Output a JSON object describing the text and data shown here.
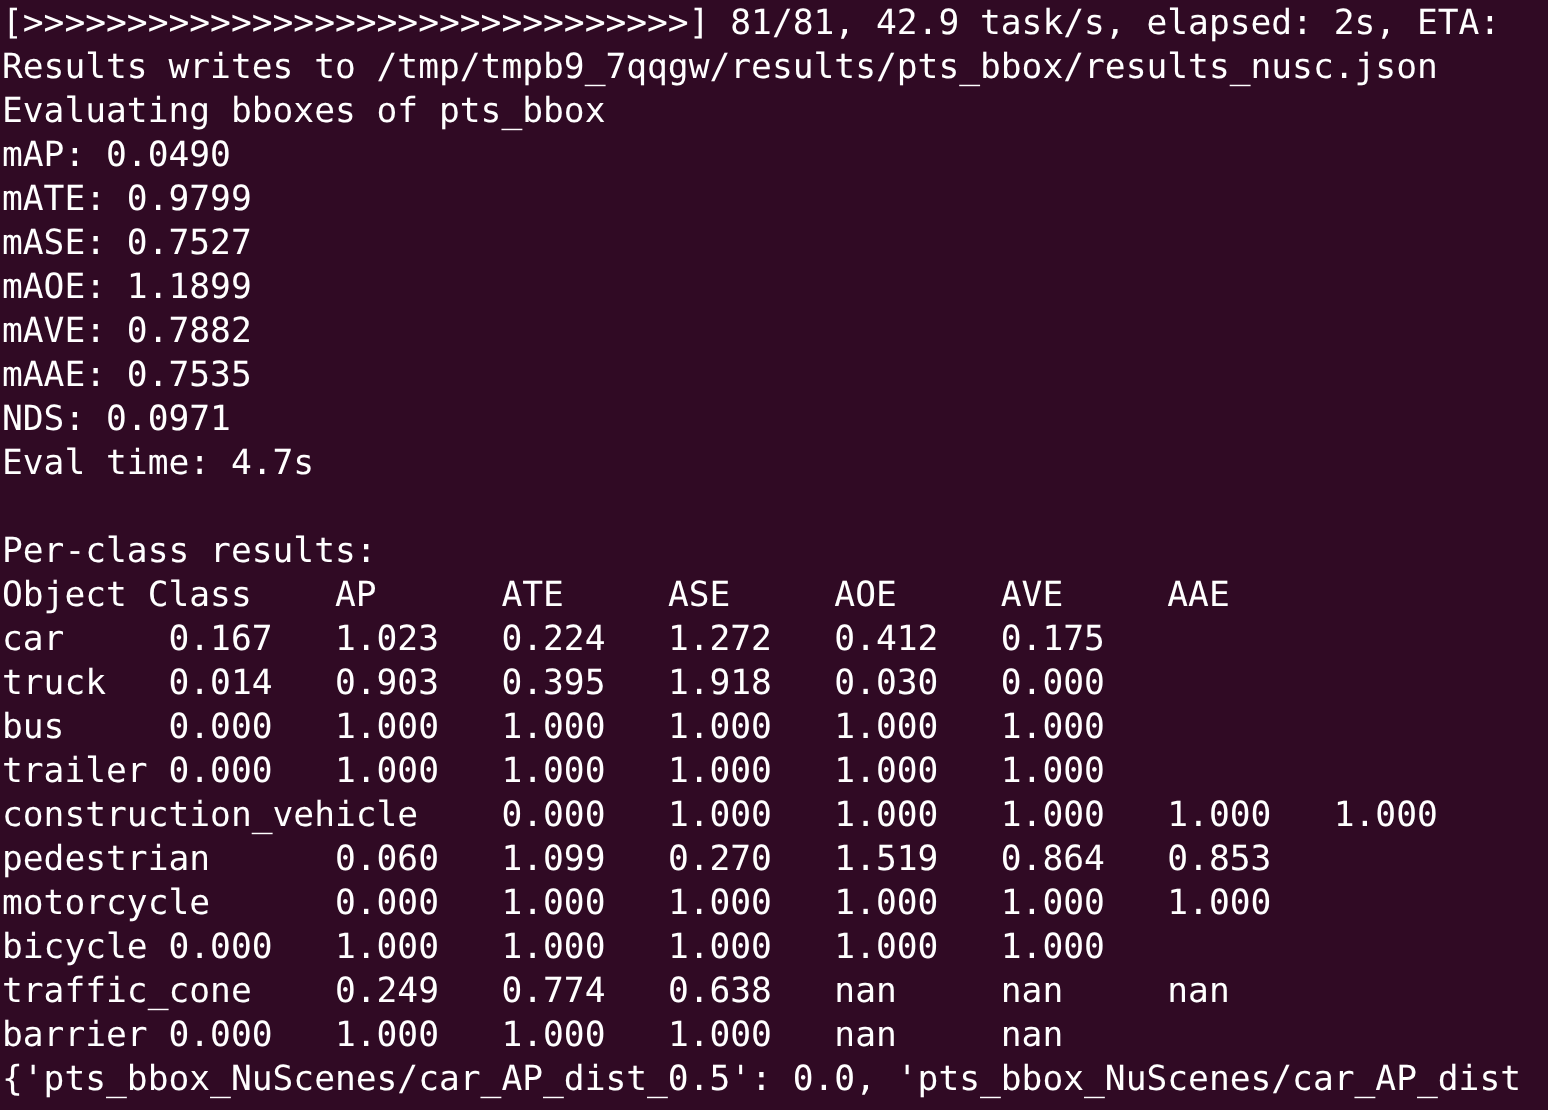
{
  "terminal": {
    "blocks": [
      {
        "lines": [
          "[>>>>>>>>>>>>>>>>>>>>>>>>>>>>>>>>] 81/81, 42.9 task/s, elapsed: 2s, ETA:",
          "Results writes to /tmp/tmpb9_7qqgw/results/pts_bbox/results_nusc.json",
          "Evaluating bboxes of pts_bbox",
          "mAP: 0.0490",
          "mATE: 0.9799",
          "mASE: 0.7527",
          "mAOE: 1.1899",
          "mAVE: 0.7882",
          "mAAE: 0.7535",
          "NDS: 0.0971",
          "Eval time: 4.7s"
        ]
      },
      {
        "lines": [
          "Per-class results:",
          "Object Class\tAP\tATE\tASE\tAOE\tAVE\tAAE",
          "car\t0.167\t1.023\t0.224\t1.272\t0.412\t0.175",
          "truck\t0.014\t0.903\t0.395\t1.918\t0.030\t0.000",
          "bus\t0.000\t1.000\t1.000\t1.000\t1.000\t1.000",
          "trailer\t0.000\t1.000\t1.000\t1.000\t1.000\t1.000",
          "construction_vehicle\t0.000\t1.000\t1.000\t1.000\t1.000\t1.000",
          "pedestrian\t0.060\t1.099\t0.270\t1.519\t0.864\t0.853",
          "motorcycle\t0.000\t1.000\t1.000\t1.000\t1.000\t1.000",
          "bicycle\t0.000\t1.000\t1.000\t1.000\t1.000\t1.000",
          "traffic_cone\t0.249\t0.774\t0.638\tnan\tnan\tnan",
          "barrier\t0.000\t1.000\t1.000\t1.000\tnan\tnan",
          "{'pts_bbox_NuScenes/car_AP_dist_0.5': 0.0, 'pts_bbox_NuScenes/car_AP_dist"
        ]
      }
    ]
  }
}
